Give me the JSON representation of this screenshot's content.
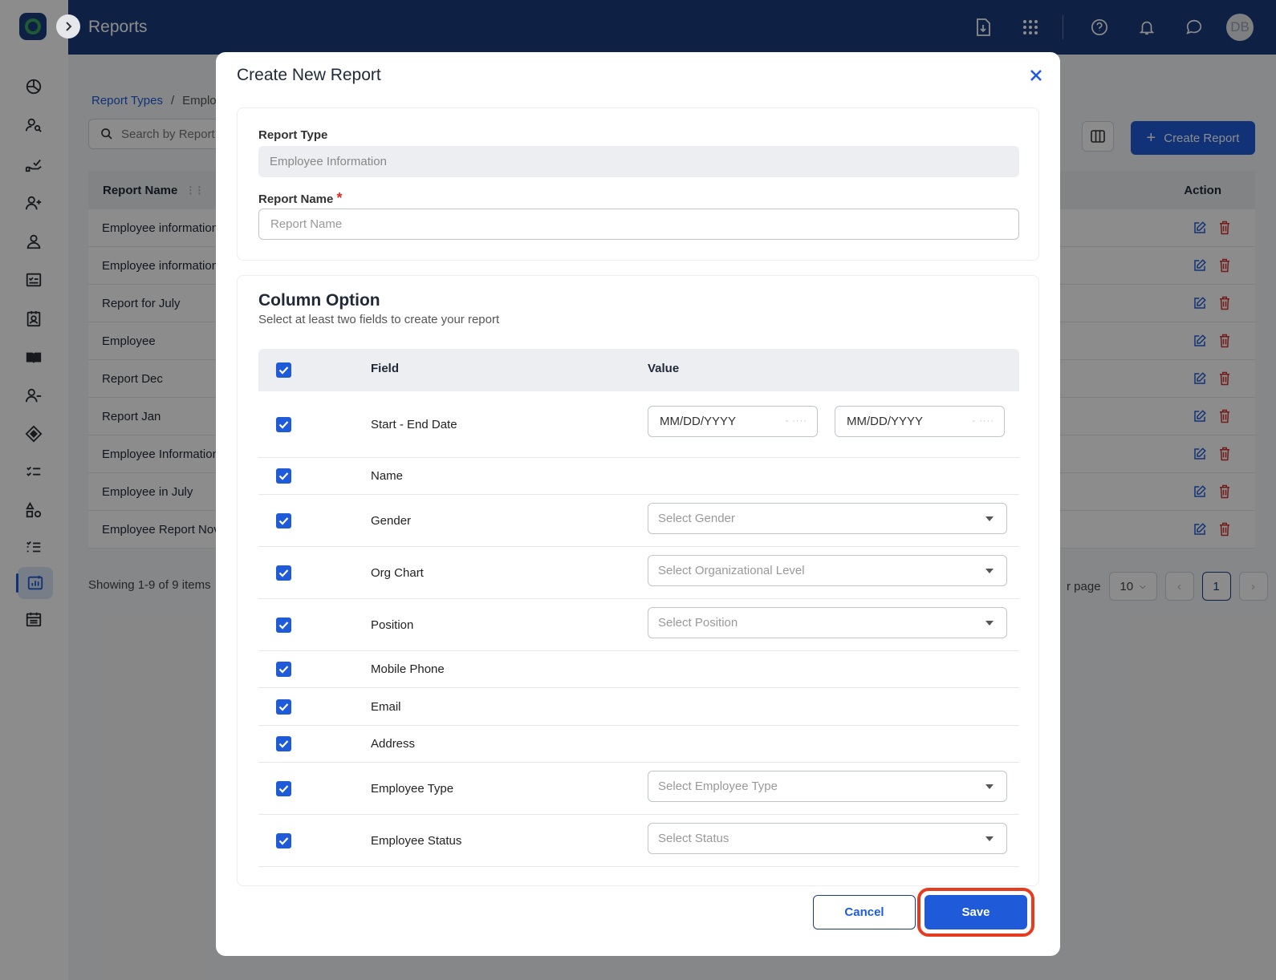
{
  "header": {
    "title": "Reports",
    "avatar_initials": "DB",
    "icons": [
      "download-report-icon",
      "apps-grid-icon",
      "help-icon",
      "notification-bell-icon",
      "chat-icon"
    ]
  },
  "sidebar": {
    "items": [
      "dashboard-icon",
      "employee-search-icon",
      "onboarding-icon",
      "add-user-icon",
      "user-icon",
      "checklist-board-icon",
      "id-badge-icon",
      "handbook-icon",
      "remove-user-icon",
      "benefits-icon",
      "tasks-icon",
      "assets-icon",
      "list-icon",
      "reports-icon",
      "calendar-icon"
    ],
    "active": "reports-icon"
  },
  "background": {
    "breadcrumb": {
      "root": "Report Types",
      "current": "Emplo"
    },
    "search_placeholder": "Search by Report",
    "create_button": "Create Report",
    "table": {
      "headers": {
        "name": "Report Name",
        "action": "Action"
      },
      "rows": [
        "Employee information",
        "Employee information",
        "Report for July",
        "Employee",
        "Report Dec",
        "Report Jan",
        "Employee Information",
        "Employee in July",
        "Employee Report Nov"
      ]
    },
    "footer_text": "Showing 1-9 of 9 items",
    "per_page_label": "r page",
    "per_page_value": "10",
    "current_page": "1"
  },
  "modal": {
    "title": "Create New Report",
    "report_type_label": "Report Type",
    "report_type_value": "Employee Information",
    "report_name_label": "Report Name",
    "report_name_placeholder": "Report Name",
    "column_option_title": "Column Option",
    "column_option_subtitle": "Select at least two fields to create your report",
    "grid_headers": {
      "field": "Field",
      "value": "Value"
    },
    "fields": [
      {
        "name": "Start - End Date",
        "checked": true,
        "date_start": "MM/DD/YYYY",
        "date_end": "MM/DD/YYYY"
      },
      {
        "name": "Name",
        "checked": true
      },
      {
        "name": "Gender",
        "checked": true,
        "select_placeholder": "Select Gender"
      },
      {
        "name": "Org Chart",
        "checked": true,
        "select_placeholder": "Select Organizational Level"
      },
      {
        "name": "Position",
        "checked": true,
        "select_placeholder": "Select Position"
      },
      {
        "name": "Mobile Phone",
        "checked": true
      },
      {
        "name": "Email",
        "checked": true
      },
      {
        "name": "Address",
        "checked": true
      },
      {
        "name": "Employee Type",
        "checked": true,
        "select_placeholder": "Select Employee Type"
      },
      {
        "name": "Employee Status",
        "checked": true,
        "select_placeholder": "Select Status"
      }
    ],
    "cancel_label": "Cancel",
    "save_label": "Save"
  },
  "colors": {
    "header": "#1a3c7c",
    "primary": "#1f5bd8",
    "highlight": "#e53b1f",
    "danger": "#d32f2f"
  }
}
